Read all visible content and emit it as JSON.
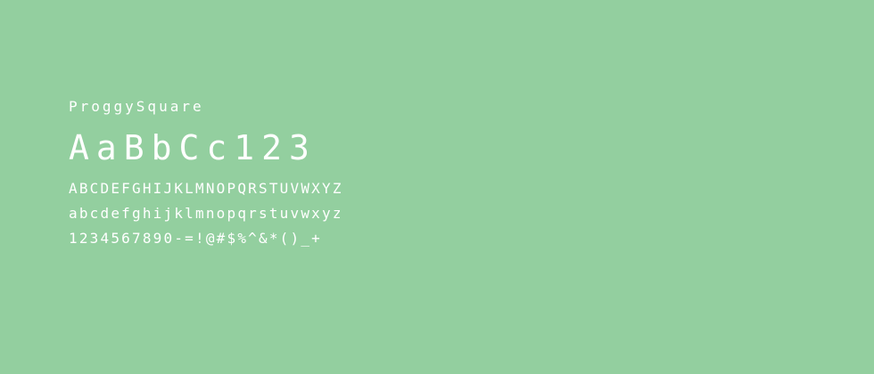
{
  "specimen": {
    "font_name": "ProggySquare",
    "sample": "AaBbCc123",
    "uppercase": "ABCDEFGHIJKLMNOPQRSTUVWXYZ",
    "lowercase": "abcdefghijklmnopqrstuvwxyz",
    "symbols": "1234567890-=!@#$%^&*()_+"
  },
  "colors": {
    "background": "#93cf9f",
    "text": "#ffffff"
  }
}
